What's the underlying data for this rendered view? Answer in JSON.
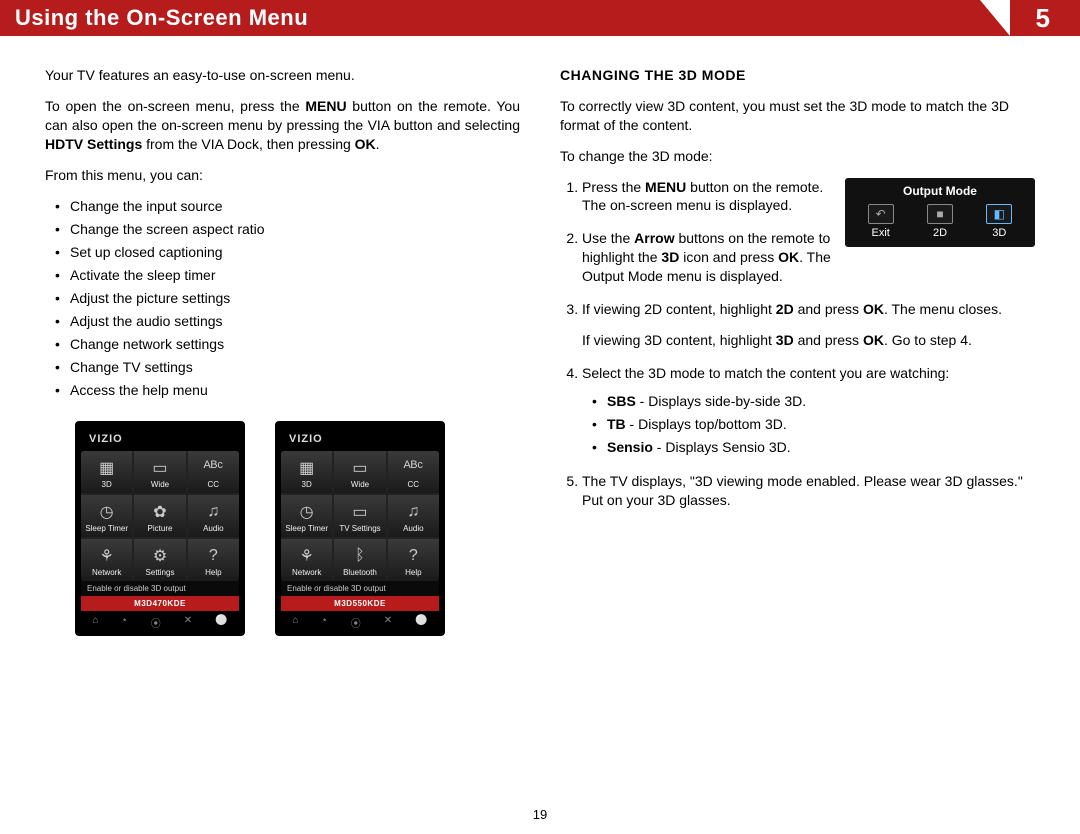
{
  "header": {
    "title": "Using the On-Screen Menu",
    "chapter": "5"
  },
  "left": {
    "intro": "Your TV features an easy-to-use on-screen menu.",
    "open": "To open the on-screen menu, press the MENU button on the remote. You can also open the on-screen menu by pressing the VIA button and selecting HDTV Settings from the VIA Dock, then pressing OK.",
    "open_html": "To open the on-screen menu, press the <b>MENU</b> button on the remote. You can also open the on-screen menu by pressing the VIA button and selecting <b>HDTV Settings</b> from the VIA Dock, then pressing <b>OK</b>.",
    "from_menu": "From this menu, you can:",
    "bullets": [
      "Change the input source",
      "Change the screen aspect ratio",
      "Set up closed captioning",
      "Activate the sleep timer",
      "Adjust the picture settings",
      "Adjust the audio settings",
      "Change network settings",
      "Change TV settings",
      "Access the help menu"
    ]
  },
  "phones": {
    "brand": "VIZIO",
    "caption": "Enable or disable 3D output",
    "dock": [
      "⌂",
      "⋆",
      "⦿",
      "✕",
      "⚪"
    ],
    "a": {
      "model": "M3D470KDE",
      "cells": [
        {
          "icon": "▦",
          "label": "3D"
        },
        {
          "icon": "▭",
          "label": "Wide"
        },
        {
          "icon": "ᴬᴮᶜ",
          "label": "CC"
        },
        {
          "icon": "◷",
          "label": "Sleep Timer"
        },
        {
          "icon": "✿",
          "label": "Picture"
        },
        {
          "icon": "♫",
          "label": "Audio"
        },
        {
          "icon": "⚘",
          "label": "Network"
        },
        {
          "icon": "⚙",
          "label": "Settings"
        },
        {
          "icon": "?",
          "label": "Help"
        }
      ]
    },
    "b": {
      "model": "M3D550KDE",
      "cells": [
        {
          "icon": "▦",
          "label": "3D"
        },
        {
          "icon": "▭",
          "label": "Wide"
        },
        {
          "icon": "ᴬᴮᶜ",
          "label": "CC"
        },
        {
          "icon": "◷",
          "label": "Sleep Timer"
        },
        {
          "icon": "▭",
          "label": "TV Settings"
        },
        {
          "icon": "♫",
          "label": "Audio"
        },
        {
          "icon": "⚘",
          "label": "Network"
        },
        {
          "icon": "ᛒ",
          "label": "Bluetooth"
        },
        {
          "icon": "?",
          "label": "Help"
        }
      ]
    }
  },
  "right": {
    "heading": "CHANGING THE 3D MODE",
    "p1": "To correctly view 3D content, you must set the 3D mode to match the 3D format of the content.",
    "p2": "To change the 3D mode:",
    "output_mode": {
      "title": "Output Mode",
      "items": [
        {
          "icon": "↶",
          "label": "Exit"
        },
        {
          "icon": "■",
          "label": "2D"
        },
        {
          "icon": "◧",
          "label": "3D"
        }
      ],
      "selected": 2
    },
    "steps": {
      "s1_html": "Press the <b>MENU</b> button on the remote. The on-screen menu is displayed.",
      "s2_html": "Use the <b>Arrow</b> buttons on the remote to highlight the <b>3D</b> icon and press <b>OK</b>. The Output Mode menu is displayed.",
      "s3a_html": "If viewing 2D content, highlight <b>2D</b> and press <b>OK</b>. The menu closes.",
      "s3b_html": "If viewing 3D content, highlight <b>3D</b> and press <b>OK</b>. Go to step 4.",
      "s4": "Select the 3D mode to match the content you are watching:",
      "s4_bullets": [
        "<b>SBS</b> - Displays side-by-side 3D.",
        "<b>TB</b> - Displays top/bottom 3D.",
        "<b>Sensio</b> - Displays Sensio 3D."
      ],
      "s5": "The TV displays, \"3D viewing mode enabled. Please wear 3D glasses.\" Put on your 3D glasses."
    }
  },
  "page": "19"
}
